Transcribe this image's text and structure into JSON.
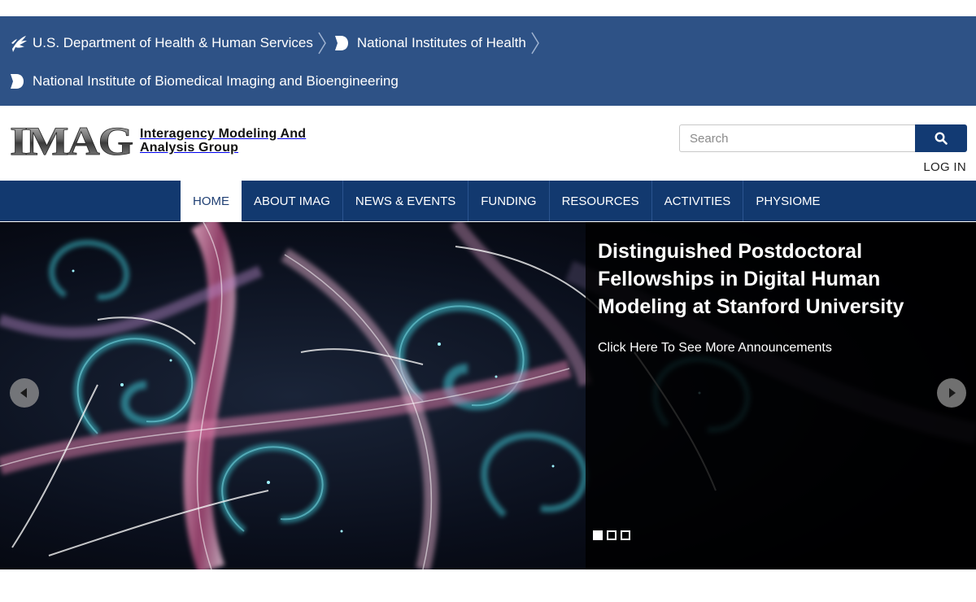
{
  "gov_banner": {
    "hhs": {
      "label": "U.S. Department of Health & Human Services",
      "icon": "hhs-eagle-icon"
    },
    "nih": {
      "label": "National Institutes of Health",
      "icon": "nih-icon"
    },
    "nibib": {
      "label": "National Institute of Biomedical Imaging and Bioengineering",
      "icon": "nih-icon"
    }
  },
  "header": {
    "logo_mark": "IMAG",
    "logo_line1": "Interagency Modeling And",
    "logo_line2": "Analysis Group",
    "search_placeholder": "Search",
    "search_icon": "search-icon",
    "login_label": "LOG IN"
  },
  "nav": {
    "items": [
      {
        "label": "HOME",
        "active": true
      },
      {
        "label": "ABOUT IMAG"
      },
      {
        "label": "NEWS & EVENTS"
      },
      {
        "label": "FUNDING"
      },
      {
        "label": "RESOURCES"
      },
      {
        "label": "ACTIVITIES"
      },
      {
        "label": "PHYSIOME"
      }
    ]
  },
  "hero": {
    "title": "Distinguished Postdoctoral Fellowships in Digital Human Modeling at Stanford University",
    "link": "Click Here To See More Announcements",
    "prev_icon": "chevron-left-icon",
    "next_icon": "chevron-right-icon",
    "slide_count": 3,
    "active_slide": 1
  },
  "colors": {
    "gov_banner": "#2e5286",
    "nav": "#12396f",
    "search_button": "#123a73"
  }
}
